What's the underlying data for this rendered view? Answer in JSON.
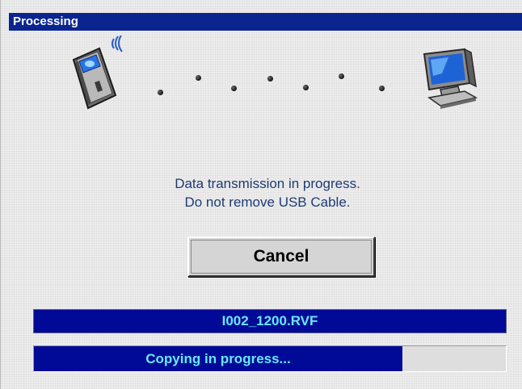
{
  "window": {
    "title": "Processing"
  },
  "transfer": {
    "source_icon": "usb-device-icon",
    "target_icon": "computer-monitor-icon",
    "signal_icon": "wireless-signal-icon",
    "dot_count": 7
  },
  "message": {
    "line1": "Data transmission in progress.",
    "line2": "Do not remove USB Cable."
  },
  "buttons": {
    "cancel_label": "Cancel"
  },
  "file": {
    "name": "I002_1200.RVF"
  },
  "progress": {
    "label": "Copying in progress...",
    "fraction": 0.78
  },
  "colors": {
    "titlebar": "#0a2490",
    "bar": "#000a96",
    "bar_text": "#68e8ff",
    "message_text": "#1e3b73"
  }
}
